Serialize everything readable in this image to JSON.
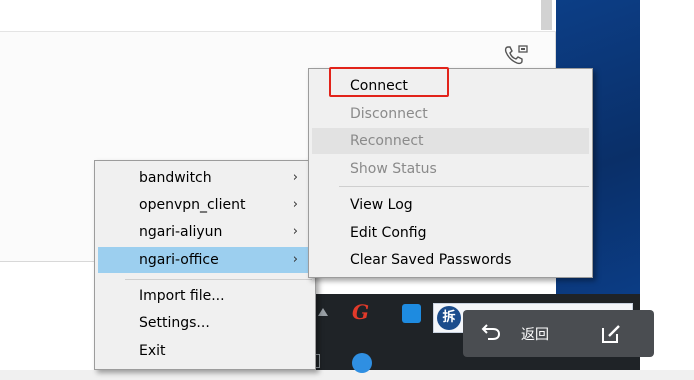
{
  "main_menu": {
    "items": [
      {
        "label": "bandwitch",
        "has_submenu": true
      },
      {
        "label": "openvpn_client",
        "has_submenu": true
      },
      {
        "label": "ngari-aliyun",
        "has_submenu": true
      },
      {
        "label": "ngari-office",
        "has_submenu": true,
        "selected": true
      },
      {
        "label": "Import file..."
      },
      {
        "label": "Settings..."
      },
      {
        "label": "Exit"
      }
    ]
  },
  "submenu": {
    "items": [
      {
        "label": "Connect",
        "enabled": true
      },
      {
        "label": "Disconnect",
        "enabled": false
      },
      {
        "label": "Reconnect",
        "enabled": false
      },
      {
        "label": "Show Status",
        "enabled": false
      },
      {
        "label": "View Log",
        "enabled": true
      },
      {
        "label": "Edit Config",
        "enabled": true
      },
      {
        "label": "Clear Saved Passwords",
        "enabled": true
      }
    ]
  },
  "submenu_arrow": "›",
  "taskbar": {
    "back_label": "返回",
    "ime_logo_char": "拆"
  },
  "icons": {
    "phone": "phone-icon",
    "back": "back-arrow-icon",
    "edit": "edit-icon"
  },
  "colors": {
    "selected_item": "#9ccfef",
    "highlight_box": "#e2231a",
    "menu_bg": "#f0f0f0",
    "disabled_text": "#8a8a8a"
  }
}
